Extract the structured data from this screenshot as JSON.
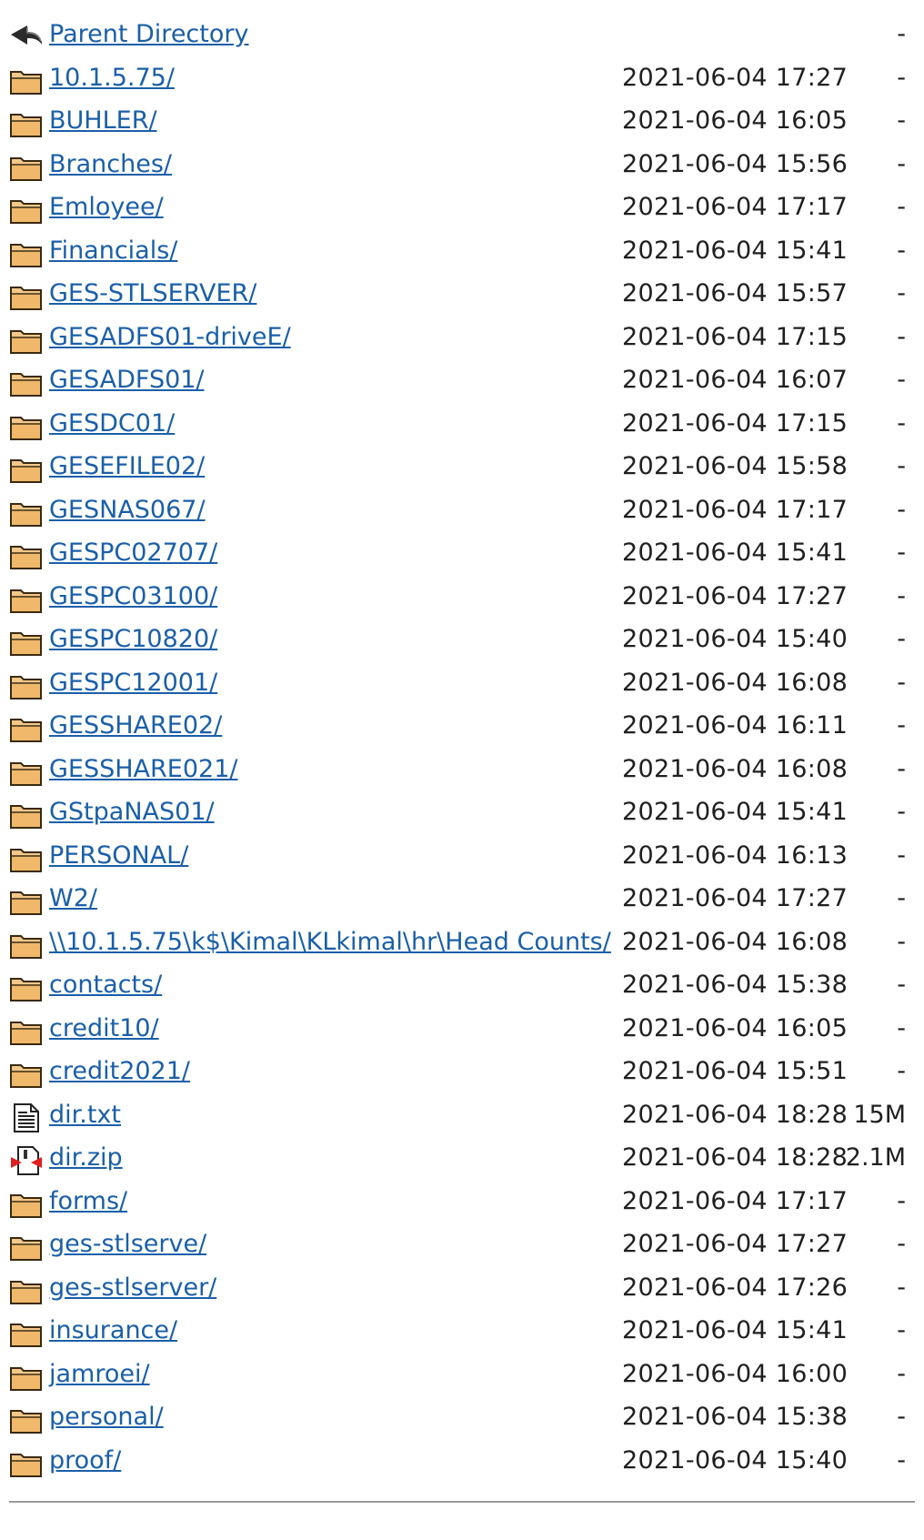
{
  "listing": {
    "rows": [
      {
        "icon": "back-arrow-icon",
        "name": "Parent Directory",
        "date": "",
        "size": "-"
      },
      {
        "icon": "folder-icon",
        "name": "10.1.5.75/",
        "date": "2021-06-04 17:27",
        "size": "-"
      },
      {
        "icon": "folder-icon",
        "name": "BUHLER/",
        "date": "2021-06-04 16:05",
        "size": "-"
      },
      {
        "icon": "folder-icon",
        "name": "Branches/",
        "date": "2021-06-04 15:56",
        "size": "-"
      },
      {
        "icon": "folder-icon",
        "name": "Emloyee/",
        "date": "2021-06-04 17:17",
        "size": "-"
      },
      {
        "icon": "folder-icon",
        "name": "Financials/",
        "date": "2021-06-04 15:41",
        "size": "-"
      },
      {
        "icon": "folder-icon",
        "name": "GES-STLSERVER/",
        "date": "2021-06-04 15:57",
        "size": "-"
      },
      {
        "icon": "folder-icon",
        "name": "GESADFS01-driveE/",
        "date": "2021-06-04 17:15",
        "size": "-"
      },
      {
        "icon": "folder-icon",
        "name": "GESADFS01/",
        "date": "2021-06-04 16:07",
        "size": "-"
      },
      {
        "icon": "folder-icon",
        "name": "GESDC01/",
        "date": "2021-06-04 17:15",
        "size": "-"
      },
      {
        "icon": "folder-icon",
        "name": "GESEFILE02/",
        "date": "2021-06-04 15:58",
        "size": "-"
      },
      {
        "icon": "folder-icon",
        "name": "GESNAS067/",
        "date": "2021-06-04 17:17",
        "size": "-"
      },
      {
        "icon": "folder-icon",
        "name": "GESPC02707/",
        "date": "2021-06-04 15:41",
        "size": "-"
      },
      {
        "icon": "folder-icon",
        "name": "GESPC03100/",
        "date": "2021-06-04 17:27",
        "size": "-"
      },
      {
        "icon": "folder-icon",
        "name": "GESPC10820/",
        "date": "2021-06-04 15:40",
        "size": "-"
      },
      {
        "icon": "folder-icon",
        "name": "GESPC12001/",
        "date": "2021-06-04 16:08",
        "size": "-"
      },
      {
        "icon": "folder-icon",
        "name": "GESSHARE02/",
        "date": "2021-06-04 16:11",
        "size": "-"
      },
      {
        "icon": "folder-icon",
        "name": "GESSHARE021/",
        "date": "2021-06-04 16:08",
        "size": "-"
      },
      {
        "icon": "folder-icon",
        "name": "GStpaNAS01/",
        "date": "2021-06-04 15:41",
        "size": "-"
      },
      {
        "icon": "folder-icon",
        "name": "PERSONAL/",
        "date": "2021-06-04 16:13",
        "size": "-"
      },
      {
        "icon": "folder-icon",
        "name": "W2/",
        "date": "2021-06-04 17:27",
        "size": "-"
      },
      {
        "icon": "folder-icon",
        "name": "\\\\10.1.5.75\\k$\\Kimal\\KLkimal\\hr\\Head Counts/",
        "date": "2021-06-04 16:08",
        "size": "-"
      },
      {
        "icon": "folder-icon",
        "name": "contacts/",
        "date": "2021-06-04 15:38",
        "size": "-"
      },
      {
        "icon": "folder-icon",
        "name": "credit10/",
        "date": "2021-06-04 16:05",
        "size": "-"
      },
      {
        "icon": "folder-icon",
        "name": "credit2021/",
        "date": "2021-06-04 15:51",
        "size": "-"
      },
      {
        "icon": "text-file-icon",
        "name": "dir.txt",
        "date": "2021-06-04 18:28",
        "size": "15M"
      },
      {
        "icon": "compressed-file-icon",
        "name": "dir.zip",
        "date": "2021-06-04 18:28",
        "size": "2.1M"
      },
      {
        "icon": "folder-icon",
        "name": "forms/",
        "date": "2021-06-04 17:17",
        "size": "-"
      },
      {
        "icon": "folder-icon",
        "name": "ges-stlserve/",
        "date": "2021-06-04 17:27",
        "size": "-"
      },
      {
        "icon": "folder-icon",
        "name": "ges-stlserver/",
        "date": "2021-06-04 17:26",
        "size": "-"
      },
      {
        "icon": "folder-icon",
        "name": "insurance/",
        "date": "2021-06-04 15:41",
        "size": "-"
      },
      {
        "icon": "folder-icon",
        "name": "jamroei/",
        "date": "2021-06-04 16:00",
        "size": "-"
      },
      {
        "icon": "folder-icon",
        "name": "personal/",
        "date": "2021-06-04 15:38",
        "size": "-"
      },
      {
        "icon": "folder-icon",
        "name": "proof/",
        "date": "2021-06-04 15:40",
        "size": "-"
      }
    ]
  },
  "colors": {
    "link": "#1a5fa8",
    "folder_fill": "#f3c88a",
    "folder_stroke": "#3a2a10",
    "rule": "#9a9a9a"
  }
}
